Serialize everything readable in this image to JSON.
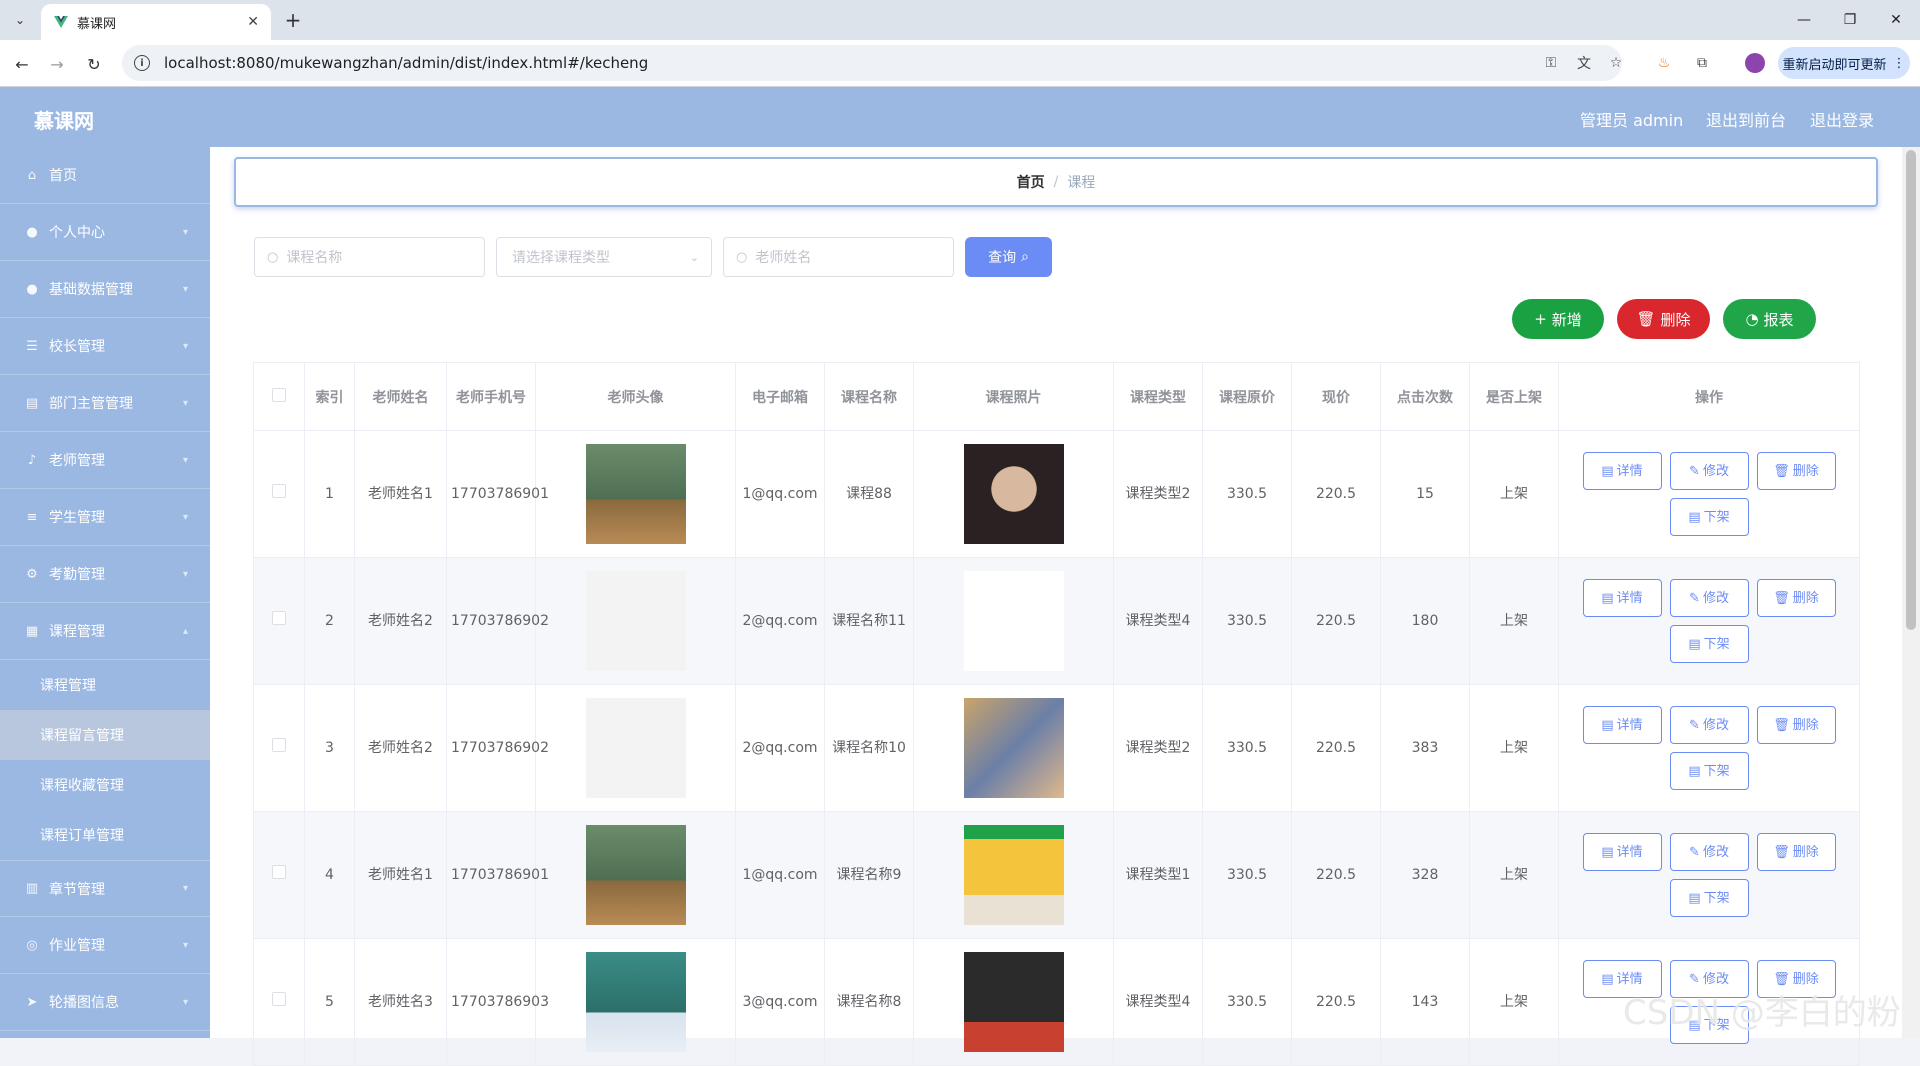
{
  "browser": {
    "tab_title": "慕课网",
    "url": "localhost:8080/mukewangzhan/admin/dist/index.html#/kecheng",
    "update_label": "重新启动即可更新"
  },
  "header": {
    "logo": "慕课网",
    "admin_label": "管理员 admin",
    "to_front_label": "退出到前台",
    "logout_label": "退出登录"
  },
  "sidebar": {
    "items": [
      {
        "label": "首页",
        "icon": "home-icon"
      },
      {
        "label": "个人中心",
        "icon": "user-icon"
      },
      {
        "label": "基础数据管理",
        "icon": "user-icon"
      },
      {
        "label": "校长管理",
        "icon": "list-icon"
      },
      {
        "label": "部门主管管理",
        "icon": "clipboard-icon"
      },
      {
        "label": "老师管理",
        "icon": "mic-icon"
      },
      {
        "label": "学生管理",
        "icon": "menu-icon"
      },
      {
        "label": "考勤管理",
        "icon": "settings-icon"
      },
      {
        "label": "课程管理",
        "icon": "document-icon"
      }
    ],
    "sub_items": [
      "课程管理",
      "课程留言管理",
      "课程收藏管理",
      "课程订单管理"
    ],
    "bottom_items": [
      {
        "label": "章节管理",
        "icon": "grid-icon"
      },
      {
        "label": "作业管理",
        "icon": "globe-icon"
      },
      {
        "label": "轮播图信息",
        "icon": "send-icon"
      }
    ]
  },
  "breadcrumb": {
    "home": "首页",
    "separator": "/",
    "current": "课程"
  },
  "filters": {
    "course_name_placeholder": "课程名称",
    "course_type_placeholder": "请选择课程类型",
    "teacher_name_placeholder": "老师姓名",
    "query_label": "查询"
  },
  "actions": {
    "add_label": "新增",
    "delete_label": "删除",
    "report_label": "报表"
  },
  "table": {
    "headers": [
      "索引",
      "老师姓名",
      "老师手机号",
      "老师头像",
      "电子邮箱",
      "课程名称",
      "课程照片",
      "课程类型",
      "课程原价",
      "现价",
      "点击次数",
      "是否上架",
      "操作"
    ],
    "ops": {
      "detail": "详情",
      "edit": "修改",
      "delete": "删除",
      "off_shelf": "下架"
    },
    "rows": [
      {
        "index": "1",
        "teacher": "老师姓名1",
        "phone": "17703786901",
        "email": "1@qq.com",
        "course": "课程88",
        "type": "课程类型2",
        "price": "330.5",
        "now": "220.5",
        "clicks": "15",
        "shelf": "上架"
      },
      {
        "index": "2",
        "teacher": "老师姓名2",
        "phone": "17703786902",
        "email": "2@qq.com",
        "course": "课程名称11",
        "type": "课程类型4",
        "price": "330.5",
        "now": "220.5",
        "clicks": "180",
        "shelf": "上架"
      },
      {
        "index": "3",
        "teacher": "老师姓名2",
        "phone": "17703786902",
        "email": "2@qq.com",
        "course": "课程名称10",
        "type": "课程类型2",
        "price": "330.5",
        "now": "220.5",
        "clicks": "383",
        "shelf": "上架"
      },
      {
        "index": "4",
        "teacher": "老师姓名1",
        "phone": "17703786901",
        "email": "1@qq.com",
        "course": "课程名称9",
        "type": "课程类型1",
        "price": "330.5",
        "now": "220.5",
        "clicks": "328",
        "shelf": "上架"
      },
      {
        "index": "5",
        "teacher": "老师姓名3",
        "phone": "17703786903",
        "email": "3@qq.com",
        "course": "课程名称8",
        "type": "课程类型4",
        "price": "330.5",
        "now": "220.5",
        "clicks": "143",
        "shelf": "上架"
      }
    ]
  },
  "watermark": "CSDN @李白的粉",
  "colors": {
    "header": "#9bb8e2",
    "primary": "#6c8cf5",
    "add": "#1aa142",
    "delete": "#d9272d",
    "report": "#20a548"
  }
}
